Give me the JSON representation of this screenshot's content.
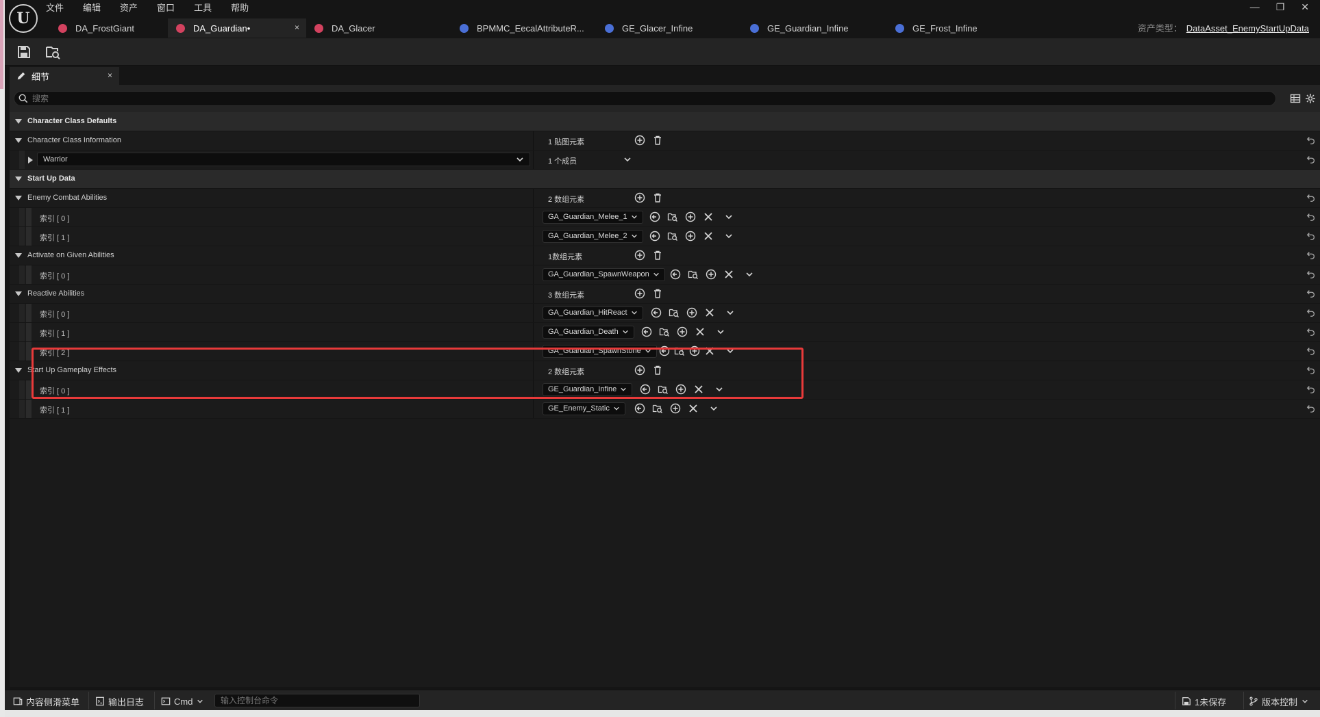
{
  "menu": [
    "文件",
    "编辑",
    "资产",
    "窗口",
    "工具",
    "帮助"
  ],
  "tabs": [
    {
      "label": "DA_FrostGiant",
      "kind": "data-asset",
      "color": "#d3425f"
    },
    {
      "label": "DA_Guardian•",
      "kind": "data-asset",
      "color": "#d3425f",
      "active": true
    },
    {
      "label": "DA_Glacer",
      "kind": "data-asset",
      "color": "#d3425f"
    },
    {
      "label": "BPMMC_EecalAttributeR...",
      "kind": "blueprint",
      "color": "#4a6fd6"
    },
    {
      "label": "GE_Glacer_Infine",
      "kind": "blueprint",
      "color": "#4a6fd6"
    },
    {
      "label": "GE_Guardian_Infine",
      "kind": "blueprint",
      "color": "#4a6fd6"
    },
    {
      "label": "GE_Frost_Infine",
      "kind": "blueprint",
      "color": "#4a6fd6"
    }
  ],
  "tab_close": "×",
  "asset_type": {
    "label": "资产类型：",
    "value": "DataAsset_EnemyStartUpData"
  },
  "panel": {
    "title": "细节",
    "close": "×"
  },
  "search": {
    "placeholder": "搜索"
  },
  "rows": {
    "r0": {
      "label": "Character Class Defaults"
    },
    "r1": {
      "label": "Character Class Information",
      "value": "1 贴图元素"
    },
    "r2": {
      "label": "Warrior",
      "value": "1 个成员"
    },
    "r3": {
      "label": "Start Up Data"
    },
    "r4": {
      "label": "Enemy Combat Abilities",
      "value": "2 数组元素"
    },
    "r5": {
      "label": "索引 [ 0 ]",
      "value": "GA_Guardian_Melee_1"
    },
    "r6": {
      "label": "索引 [ 1 ]",
      "value": "GA_Guardian_Melee_2"
    },
    "r7": {
      "label": "Activate on Given Abilities",
      "value": "1数组元素"
    },
    "r8": {
      "label": "索引 [ 0 ]",
      "value": "GA_Guardian_SpawnWeapon"
    },
    "r9": {
      "label": "Reactive Abilities",
      "value": "3 数组元素"
    },
    "r10": {
      "label": "索引 [ 0 ]",
      "value": "GA_Guardian_HitReact"
    },
    "r11": {
      "label": "索引 [ 1 ]",
      "value": "GA_Guardian_Death"
    },
    "r12": {
      "label": "索引 [ 2 ]",
      "value": "GA_Guardian_SpawnStone"
    },
    "r13": {
      "label": "Start Up Gameplay Effects",
      "value": "2 数组元素"
    },
    "r14": {
      "label": "索引 [ 0 ]",
      "value": "GE_Guardian_Infine"
    },
    "r15": {
      "label": "索引 [ 1 ]",
      "value": "GE_Enemy_Static"
    }
  },
  "statusbar": {
    "content_drawer": "内容侧滑菜单",
    "output_log": "输出日志",
    "cmd": "Cmd",
    "console_placeholder": "输入控制台命令",
    "unsaved": "1未保存",
    "source_control": "版本控制"
  },
  "highlight_color": "#e83a3a"
}
